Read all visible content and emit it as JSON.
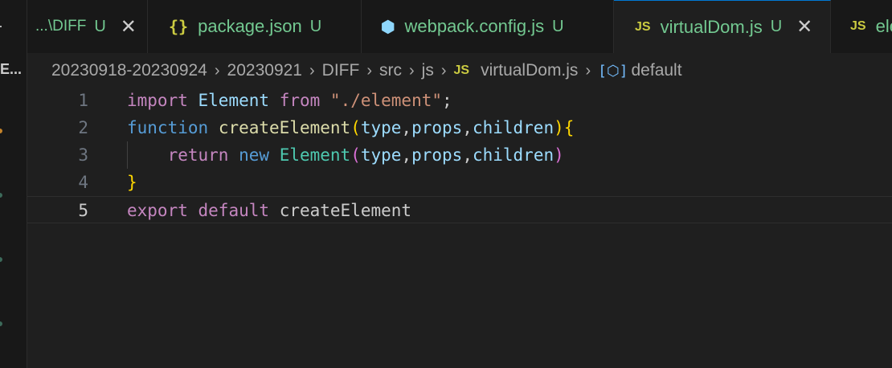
{
  "sidebar": {
    "label": "E..."
  },
  "tabs": [
    {
      "label": "...\\DIFF",
      "status": "U",
      "close": "✕",
      "icon": ""
    },
    {
      "label": "package.json",
      "status": "U",
      "icon": "{}"
    },
    {
      "label": "webpack.config.js",
      "status": "U",
      "icon": "⬢"
    },
    {
      "label": "virtualDom.js",
      "status": "U",
      "icon": "JS",
      "close": "✕"
    },
    {
      "label": "ele",
      "icon": "JS"
    }
  ],
  "breadcrumb": {
    "items": [
      "20230918-20230924",
      "20230921",
      "DIFF",
      "src",
      "js",
      "virtualDom.js",
      "default"
    ],
    "file_icon": "JS",
    "symbol_icon": "[⬡]",
    "separator": "›"
  },
  "editor": {
    "current_line": 5,
    "lines": [
      {
        "number": "1",
        "tokens": [
          "import",
          " ",
          "Element",
          " ",
          "from",
          " ",
          "\"./element\"",
          ";"
        ]
      },
      {
        "number": "2",
        "tokens": [
          "function",
          " ",
          "createElement",
          "(",
          "type",
          ",",
          "props",
          ",",
          "children",
          ")",
          "{"
        ]
      },
      {
        "number": "3",
        "tokens": [
          "    ",
          "return",
          " ",
          "new",
          " ",
          "Element",
          "(",
          "type",
          ",",
          "props",
          ",",
          "children",
          ")"
        ]
      },
      {
        "number": "4",
        "tokens": [
          "}"
        ]
      },
      {
        "number": "5",
        "tokens": [
          "export",
          " ",
          "default",
          " ",
          "createElement"
        ]
      }
    ]
  },
  "colors": {
    "background": "#1f1f1f",
    "tab_background": "#181818",
    "active_tab_border": "#0078d4",
    "untracked_file": "#73c991",
    "keyword_control": "#c586c0",
    "keyword": "#569cd6",
    "class": "#4ec9b0",
    "variable": "#9cdcfe",
    "function": "#dcdcaa",
    "string": "#ce9178"
  }
}
